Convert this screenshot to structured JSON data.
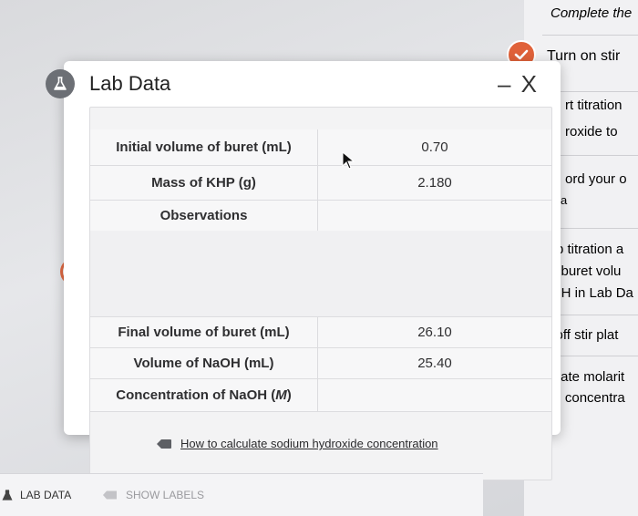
{
  "background_tasks": {
    "steps": [
      "Complete the",
      "Turn on stir",
      "rt titration",
      "roxide to",
      "ord your o",
      "a",
      "p titration a",
      "l buret volu",
      "OH in Lab Da",
      "n off stir plat",
      "culate molarit",
      "ord concentra"
    ]
  },
  "modal": {
    "title": "Lab Data",
    "close_label": "– X",
    "rows": {
      "initial_volume": {
        "label": "Initial volume of buret (mL)",
        "value": "0.70"
      },
      "mass_khp": {
        "label": "Mass of KHP (g)",
        "value": "2.180"
      },
      "observations": {
        "label": "Observations",
        "value": ""
      },
      "final_volume": {
        "label": "Final volume of buret (mL)",
        "value": "26.10"
      },
      "volume_naoh": {
        "label": "Volume of NaOH (mL)",
        "value": "25.40"
      },
      "concentration": {
        "label": "Concentration of NaOH (",
        "unit": "M",
        "label_end": ")",
        "value": ""
      }
    },
    "how_link": "How to calculate sodium hydroxide concentration"
  },
  "bottom_bar": {
    "lab_data_label": "LAB DATA",
    "show_labels": "SHOW LABELS"
  },
  "colors": {
    "accent_orange": "#e0623a",
    "badge_gray": "#6c6f75"
  }
}
